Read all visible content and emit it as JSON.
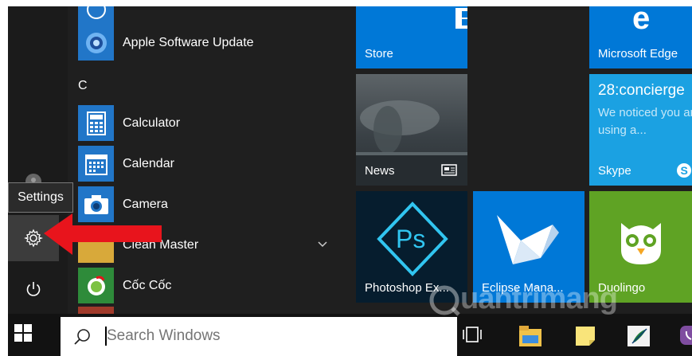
{
  "tooltip": {
    "text": "Settings"
  },
  "app_list": {
    "items": [
      {
        "type": "app",
        "label": "Apple Software Update",
        "icon": "apple-update-icon"
      },
      {
        "type": "letter",
        "label": "C"
      },
      {
        "type": "app",
        "label": "Calculator",
        "icon": "calculator-icon"
      },
      {
        "type": "app",
        "label": "Calendar",
        "icon": "calendar-icon"
      },
      {
        "type": "app",
        "label": "Camera",
        "icon": "camera-icon"
      },
      {
        "type": "app",
        "label": "Clean Master",
        "icon": "folder-icon",
        "expandable": true
      },
      {
        "type": "app",
        "label": "Cốc Cốc",
        "icon": "coccoc-icon"
      }
    ]
  },
  "tiles": {
    "store": {
      "label": "Store",
      "color": "#0078d7"
    },
    "edge": {
      "label": "Microsoft Edge",
      "color": "#0078d7"
    },
    "news": {
      "label": "News"
    },
    "skype": {
      "title": "28:concierge",
      "body": "We noticed you are using a...",
      "label": "Skype",
      "color": "#1ba1e2"
    },
    "photoshop": {
      "label": "Photoshop Ex...",
      "logo_text": "Ps"
    },
    "eclipse": {
      "label": "Eclipse Mana...",
      "color": "#0078d7"
    },
    "duolingo": {
      "label": "Duolingo",
      "color": "#5fa324"
    }
  },
  "taskbar": {
    "search_placeholder": "Search Windows"
  },
  "watermark": {
    "text": "uantrimang"
  },
  "colors": {
    "tile_blue": "#0078d7",
    "arrow_red": "#e8141c",
    "app_icon_blue": "#2176c8"
  }
}
